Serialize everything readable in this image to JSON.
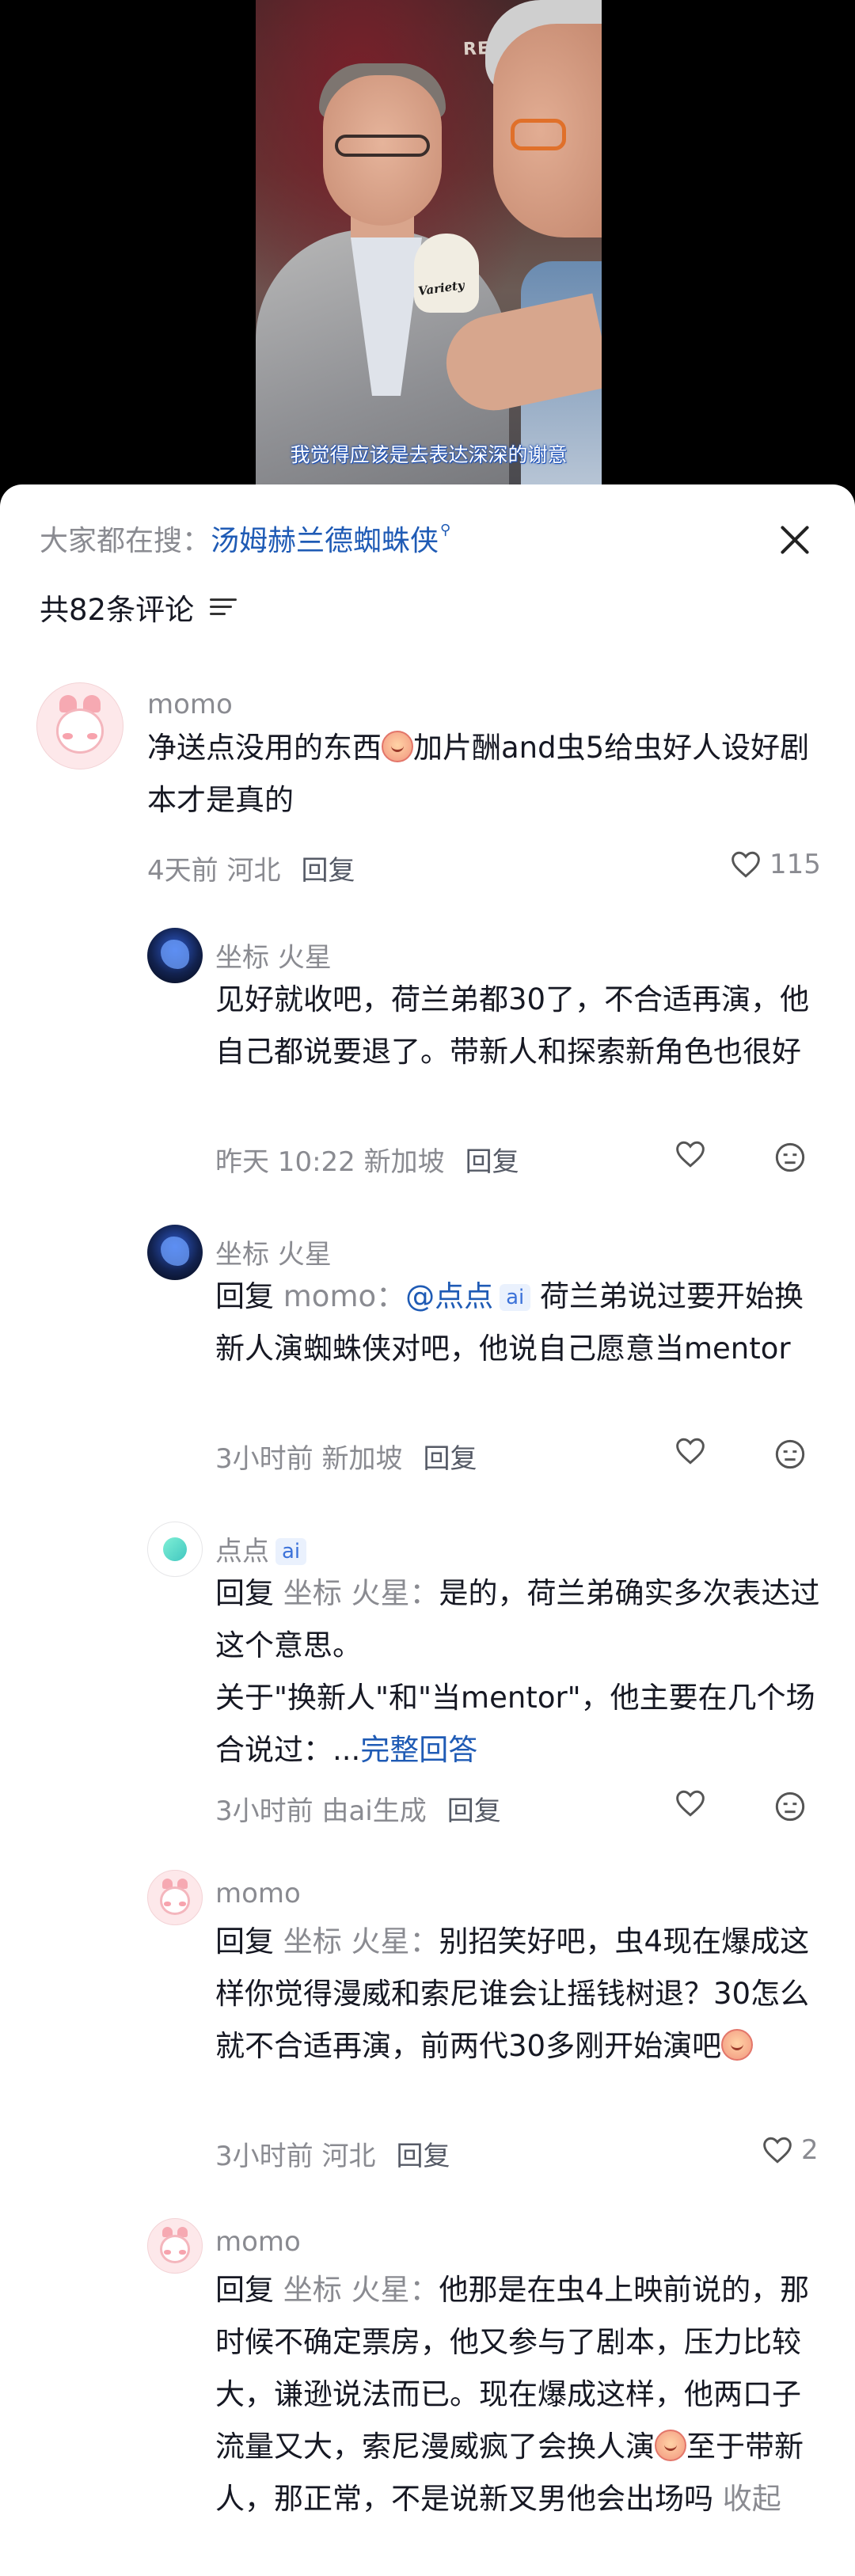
{
  "video": {
    "poster_text": "RESIDENT",
    "mic_brand": "Variety",
    "subtitle": "我觉得应该是去表达深深的谢意"
  },
  "header": {
    "search_prefix": "大家都在搜：",
    "search_term": "汤姆赫兰德蜘蛛侠",
    "search_suffix_icon": "search-icon",
    "comment_count": "共82条评论",
    "sort_icon": "sort-icon",
    "close_icon": "close-icon"
  },
  "comments": [
    {
      "user": "momo",
      "avatar": "pink-bunny-avatar",
      "text_a": "净送点没用的东西",
      "text_b": "加片酬and虫5给虫好人设好剧本才是真的",
      "time": "4天前 河北",
      "reply": "回复",
      "likes": "115"
    },
    {
      "user": "坐标 火星",
      "avatar": "blue-blob-avatar",
      "text": "见好就收吧，荷兰弟都30了，不合适再演，他自己都说要退了。带新人和探索新角色也很好",
      "time": "昨天 10:22 新加坡",
      "reply": "回复"
    },
    {
      "user": "坐标 火星",
      "avatar": "blue-blob-avatar",
      "reply_prefix": "回复",
      "reply_to": "momo：",
      "mention": "@点点",
      "ai_tag": "ai",
      "text": "荷兰弟说过要开始换新人演蜘蛛侠对吧，他说自己愿意当mentor",
      "time": "3小时前 新加坡",
      "reply": "回复"
    },
    {
      "user": "点点",
      "ai_tag": "ai",
      "avatar": "ai-avatar",
      "reply_prefix": "回复",
      "reply_to": "坐标 火星：",
      "text": "是的，荷兰弟确实多次表达过这个意思。",
      "text2": "关于\"换新人\"和\"当mentor\"，他主要在几个场合说过：...",
      "more": "完整回答",
      "time": "3小时前 由ai生成",
      "reply": "回复"
    },
    {
      "user": "momo",
      "avatar": "pink-bunny-avatar",
      "reply_prefix": "回复",
      "reply_to": "坐标 火星：",
      "text": "别招笑好吧，虫4现在爆成这样你觉得漫威和索尼谁会让摇钱树退？30怎么就不合适再演，前两代30多刚开始演吧",
      "time": "3小时前 河北",
      "reply": "回复",
      "likes": "2"
    },
    {
      "user": "momo",
      "avatar": "pink-bunny-avatar",
      "reply_prefix": "回复",
      "reply_to": "坐标 火星：",
      "text_a": "他那是在虫4上映前说的，那时候不确定票房，他又参与了剧本，压力比较大，谦逊说法而已。现在爆成这样，他两口子流量又大，索尼漫威疯了会换人演",
      "text_b": "至于带新人，那正常，不是说新叉男他会出场吗",
      "collapse": "收起"
    }
  ]
}
